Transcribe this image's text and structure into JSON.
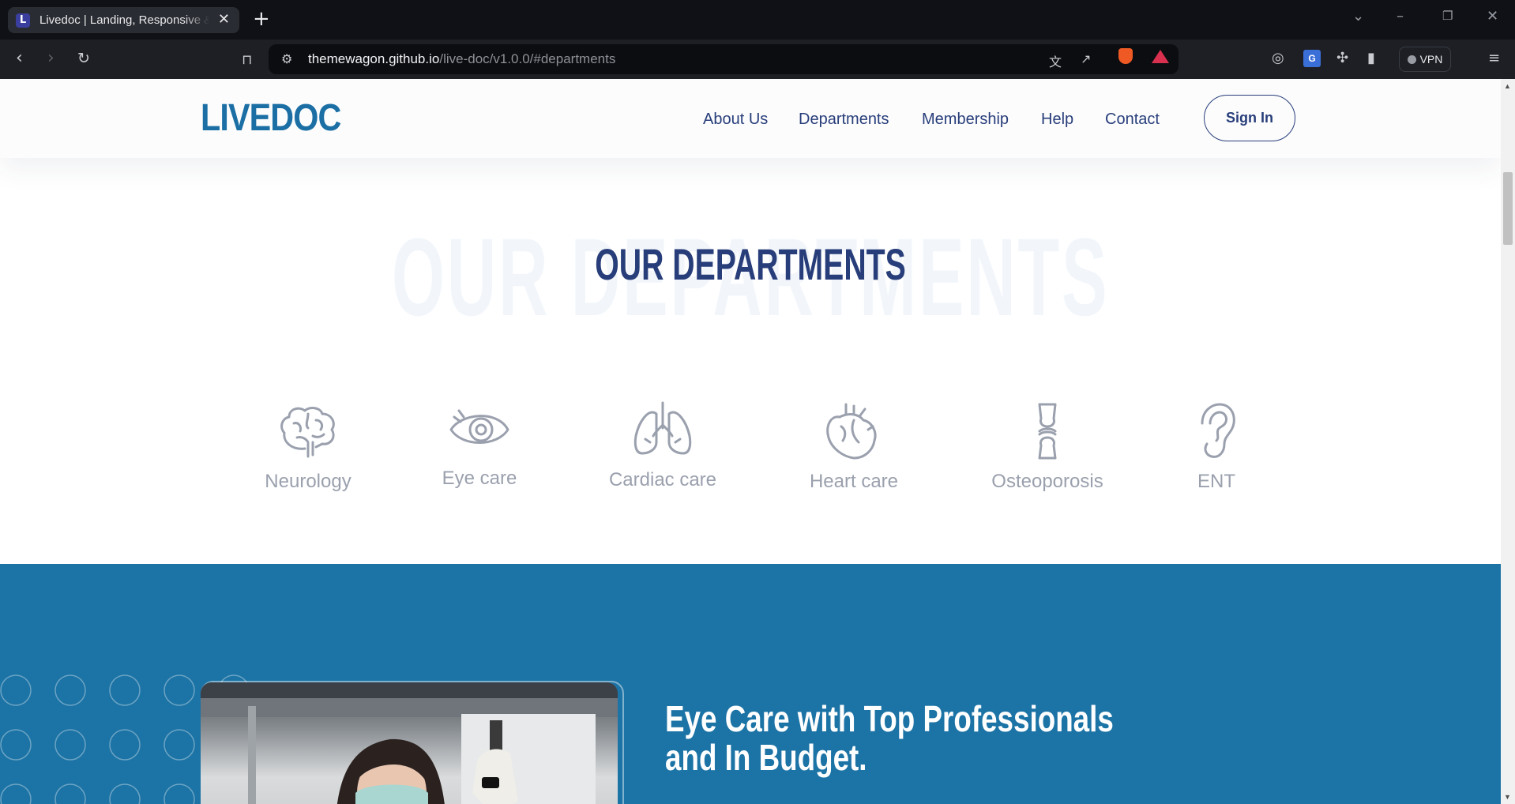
{
  "browser": {
    "tab_title": "Livedoc | Landing, Responsive & ",
    "favicon_letter": "L",
    "url_host": "themewagon.github.io",
    "url_path": "/live-doc/v1.0.0/#departments",
    "vpn_label": "VPN"
  },
  "header": {
    "logo": "LIVEDOC",
    "nav": [
      "About Us",
      "Departments",
      "Membership",
      "Help",
      "Contact"
    ],
    "signin_label": "Sign In"
  },
  "departments": {
    "bg_title": "OUR DEPARTMENTS",
    "title": "OUR DEPARTMENTS",
    "items": [
      {
        "label": "Neurology",
        "icon": "brain-icon"
      },
      {
        "label": "Eye care",
        "icon": "eye-icon"
      },
      {
        "label": "Cardiac care",
        "icon": "lungs-icon"
      },
      {
        "label": "Heart care",
        "icon": "heart-icon"
      },
      {
        "label": "Osteoporosis",
        "icon": "bone-joint-icon"
      },
      {
        "label": "ENT",
        "icon": "ear-icon"
      }
    ]
  },
  "promo": {
    "title_line1": "Eye Care with Top Professionals",
    "title_line2": "and In Budget."
  },
  "colors": {
    "brand_blue": "#1b6fa4",
    "nav_navy": "#283e7a",
    "band_blue": "#1c73a5",
    "icon_gray": "#9aa0ad"
  }
}
